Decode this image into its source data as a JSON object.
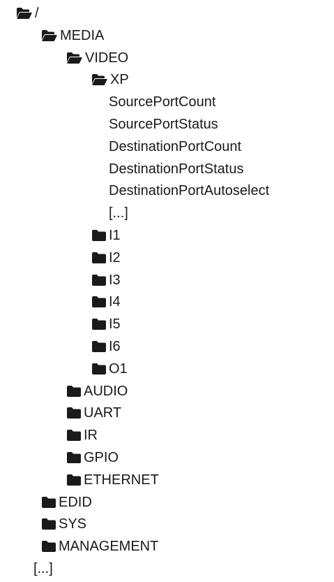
{
  "tree": {
    "nodes": [
      {
        "label": "/",
        "kind": "folder-open",
        "depth": 0
      },
      {
        "label": "MEDIA",
        "kind": "folder-open",
        "depth": 1
      },
      {
        "label": "VIDEO",
        "kind": "folder-open",
        "depth": 2
      },
      {
        "label": "XP",
        "kind": "folder-open",
        "depth": 3
      },
      {
        "label": "SourcePortCount",
        "kind": "property",
        "depth": 4
      },
      {
        "label": "SourcePortStatus",
        "kind": "property",
        "depth": 4
      },
      {
        "label": "DestinationPortCount",
        "kind": "property",
        "depth": 4
      },
      {
        "label": "DestinationPortStatus",
        "kind": "property",
        "depth": 4
      },
      {
        "label": "DestinationPortAutoselect",
        "kind": "property",
        "depth": 4
      },
      {
        "label": "[...]",
        "kind": "ellipsis",
        "depth": 4
      },
      {
        "label": "I1",
        "kind": "folder",
        "depth": 3
      },
      {
        "label": "I2",
        "kind": "folder",
        "depth": 3
      },
      {
        "label": "I3",
        "kind": "folder",
        "depth": 3
      },
      {
        "label": "I4",
        "kind": "folder",
        "depth": 3
      },
      {
        "label": "I5",
        "kind": "folder",
        "depth": 3
      },
      {
        "label": "I6",
        "kind": "folder",
        "depth": 3
      },
      {
        "label": "O1",
        "kind": "folder",
        "depth": 3
      },
      {
        "label": "AUDIO",
        "kind": "folder",
        "depth": 2
      },
      {
        "label": "UART",
        "kind": "folder",
        "depth": 2
      },
      {
        "label": "IR",
        "kind": "folder",
        "depth": 2
      },
      {
        "label": "GPIO",
        "kind": "folder",
        "depth": 2
      },
      {
        "label": "ETHERNET",
        "kind": "folder",
        "depth": 2
      },
      {
        "label": "EDID",
        "kind": "folder",
        "depth": 1
      },
      {
        "label": "SYS",
        "kind": "folder",
        "depth": 1
      },
      {
        "label": "MANAGEMENT",
        "kind": "folder",
        "depth": 1
      },
      {
        "label": "[...]",
        "kind": "ellipsis",
        "depth": 1
      }
    ]
  },
  "icons": {
    "folder-open": "folder-open-icon",
    "folder": "folder-icon"
  },
  "colors": {
    "icon": "#1a1a1a",
    "text": "#1a1a1a",
    "background": "#ffffff"
  }
}
